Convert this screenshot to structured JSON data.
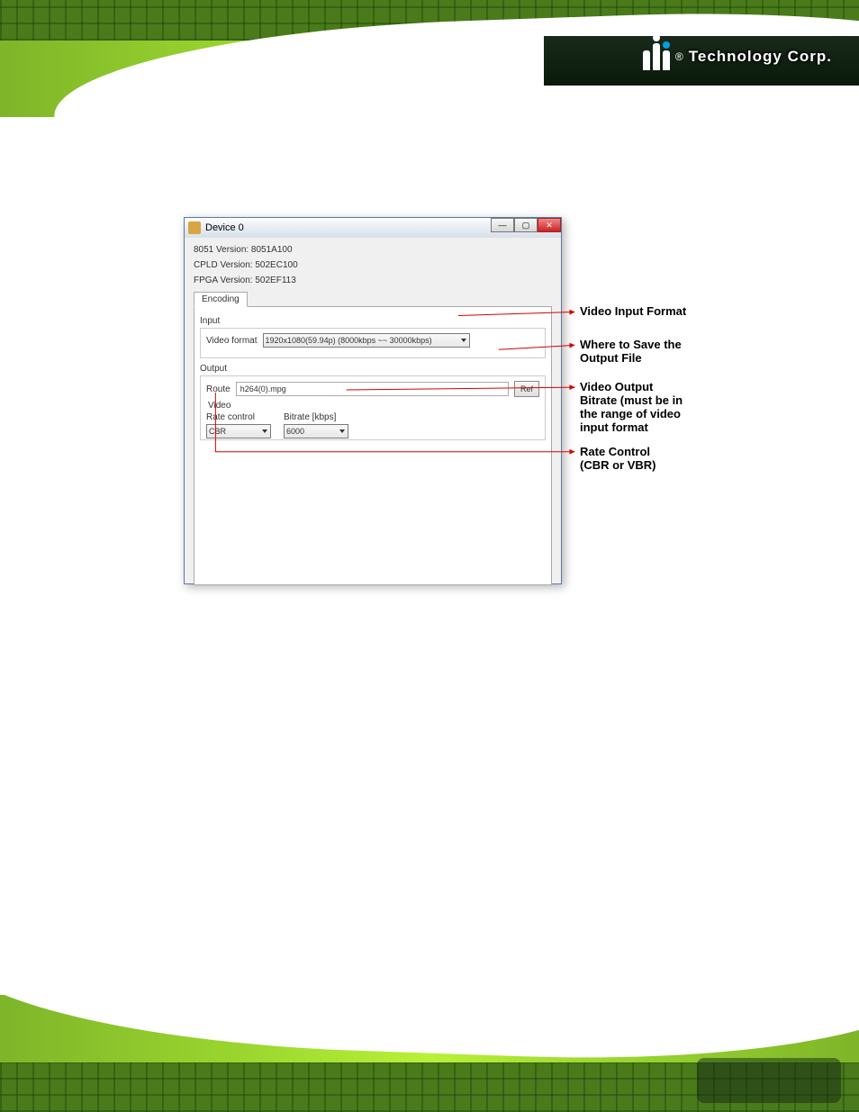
{
  "header": {
    "company_text": "Technology Corp.",
    "logo_alt": "iEi"
  },
  "dialog": {
    "title": "Device 0",
    "versions": {
      "v8051": "8051 Version: 8051A100",
      "cpld": "CPLD Version: 502EC100",
      "fpga": "FPGA Version: 502EF113"
    },
    "tab_label": "Encoding",
    "input_group": {
      "legend": "Input",
      "video_format_label": "Video format",
      "video_format_value": "1920x1080(59.94p)    (8000kbps ~~ 30000kbps)"
    },
    "output_group": {
      "legend": "Output",
      "route_label": "Route",
      "route_value": "h264(0).mpg",
      "ref_button": "Ref",
      "video_legend": "Video",
      "rate_control_label": "Rate control",
      "rate_control_value": "CBR",
      "bitrate_label": "Bitrate [kbps]",
      "bitrate_value": "6000"
    }
  },
  "callouts": {
    "c1": "Video Input Format",
    "c2_l1": "Where to Save the",
    "c2_l2": "Output File",
    "c3_l1": "Video Output",
    "c3_l2": "Bitrate (must be in",
    "c3_l3": "the range of  video",
    "c3_l4": "input format",
    "c4_l1": "Rate Control",
    "c4_l2": "(CBR or VBR)"
  },
  "colors": {
    "callout_red": "#d40000",
    "accent_green": "#8bc52f"
  }
}
